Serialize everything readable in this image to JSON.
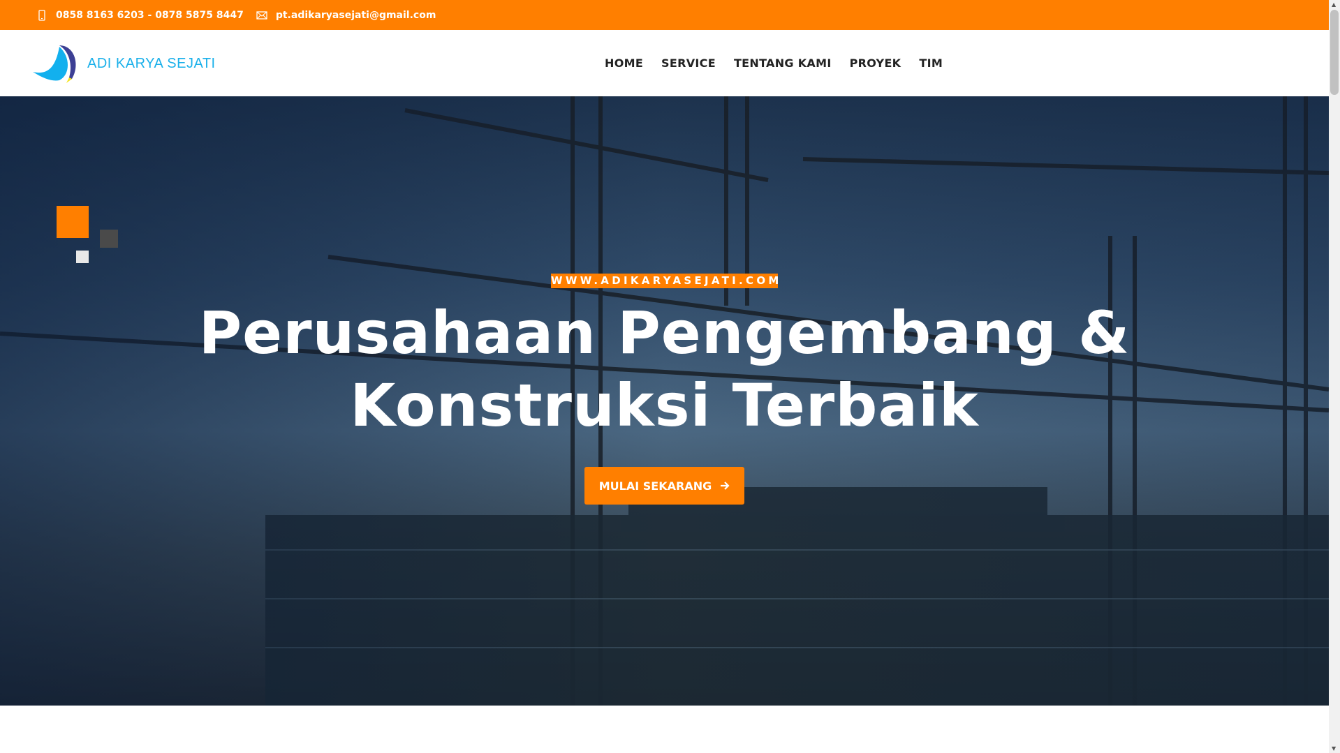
{
  "topbar": {
    "phone": "0858 8163 6203 - 0878 5875 8447",
    "email": "pt.adikaryasejati@gmail.com",
    "phone_icon": "mobile-phone-icon",
    "email_icon": "envelope-icon"
  },
  "header": {
    "logo_text": "ADI KARYA SEJATI",
    "nav": [
      {
        "label": "HOME"
      },
      {
        "label": "SERVICE"
      },
      {
        "label": "TENTANG KAMI"
      },
      {
        "label": "PROYEK"
      },
      {
        "label": "TIM"
      }
    ]
  },
  "hero": {
    "badge": "WWW.ADIKARYASEJATI.COM",
    "title_line1": "Perusahaan Pengembang &",
    "title_line2": "Konstruksi Terbaik",
    "cta_label": "MULAI SEKARANG",
    "cta_icon": "arrow-right-icon"
  },
  "colors": {
    "accent": "#ff7f00",
    "logo": "#1ab0ea"
  }
}
